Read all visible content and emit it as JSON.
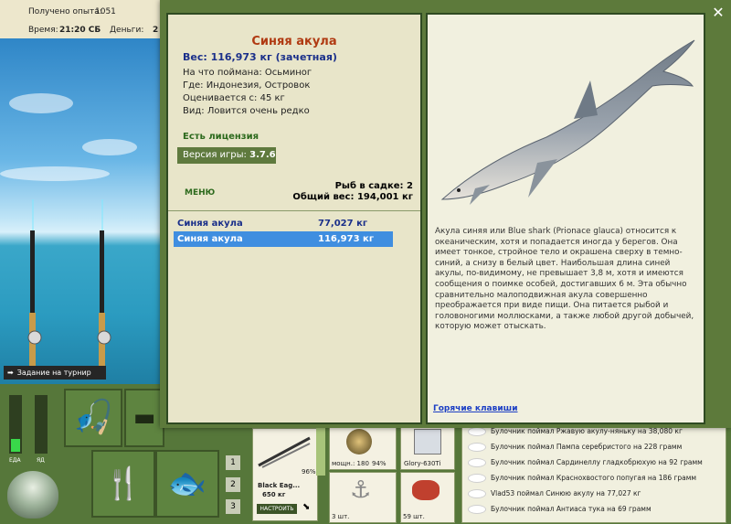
{
  "topbar": {
    "experience_label": "Получено опыта:",
    "experience_value": "1051",
    "time_label": "Время:",
    "time_value": "21:20 СБ",
    "money_label": "Деньги:",
    "money_value": "2"
  },
  "scene": {
    "tournament_task": "Задание на турнир"
  },
  "bottom": {
    "food_label": "ЕДА",
    "poison_label": "ЯД",
    "tab_numbers": [
      "1",
      "2",
      "3"
    ],
    "rod_name": "Black Eag...",
    "rod_weight": "650 кг",
    "setup_button": "НАСТРОИТЬ",
    "durability_1": "96%",
    "durability_2": "94%",
    "reel_label": "мощн.: 180",
    "line_label": "Glory-630Ti",
    "count_1": "3 шт.",
    "count_2": "59 шт."
  },
  "log": {
    "rows": [
      "Булочник поймал Ржавую акулу-няньку на 38,080 кг",
      "Булочник поймал Пампа серебристого на 228 грамм",
      "Булочник поймал Сардинеллу гладкобрюхую на 92 грамм",
      "Булочник поймал Краснохвостого попугая на 186 грамм",
      "Vlad53 поймал Синюю акулу на 77,027 кг",
      "Булочник поймал Антиаса тука на 69 грамм"
    ]
  },
  "dialog": {
    "close_glyph": "✕",
    "fish_name": "Синяя акула",
    "weight_line": "Вес: 116,973 кг (зачетная)",
    "caught_on": "На что поймана: Осьминог",
    "where": "Где: Индонезия, Островок",
    "valued_from": "Оценивается с: 45 кг",
    "view": "Вид: Ловится очень редко",
    "license": "Есть лицензия",
    "version_label": "Версия игры:",
    "version_value": "3.7.6",
    "menu_label": "МЕНЮ",
    "fish_in_net": "Рыб в садке: 2",
    "total_weight": "Общий вес: 194,001 кг",
    "catches": [
      {
        "name": "Синяя акула",
        "weight": "77,027 кг"
      },
      {
        "name": "Синяя акула",
        "weight": "116,973 кг"
      }
    ],
    "description": "Акула синяя или Blue shark (Prionace glauca) относится к океаническим, хотя и попадается иногда у берегов. Она имеет тонкое, стройное тело и окрашена сверху в темно-синий, а снизу в белый цвет. Наибольшая длина синей акулы, по-видимому, не превышает 3,8 м, хотя и имеются сообщения о поимке особей, достигавших 6 м. Эта обычно сравнительно малоподвижная акула совершенно преображается при виде пищи. Она питается рыбой и головоногими моллюсками, а также любой другой добычей, которую может отыскать.",
    "hotkeys": "Горячие клавиши"
  },
  "colors": {
    "title_red": "#b03a12",
    "weight_blue": "#1a2f8a",
    "license_green": "#2d6a1d",
    "selected_row": "#3f8ee0",
    "link_blue": "#1b3ec4"
  },
  "icons": {
    "rods": "fishing-rods-icon",
    "tackle_box": "tackle-box-icon",
    "cutlery": "fork-knife-icon",
    "fish": "fish-icon",
    "cauldron": "cauldron-icon",
    "arrow": "arrow-icon"
  }
}
